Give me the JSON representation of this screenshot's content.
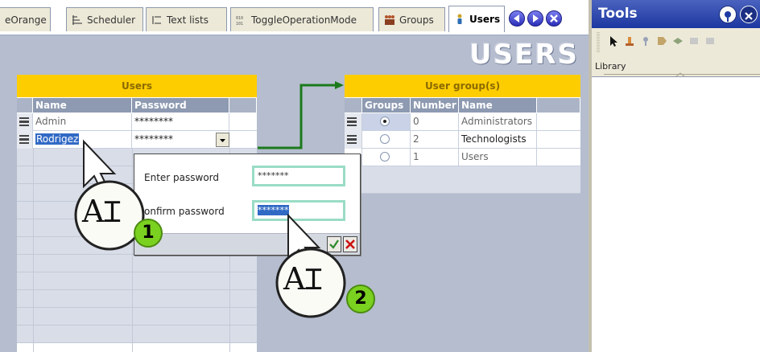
{
  "tabs": [
    {
      "label": "eOrange",
      "icon": "none"
    },
    {
      "label": "Scheduler",
      "icon": "scheduler-icon"
    },
    {
      "label": "Text lists",
      "icon": "text-list-icon"
    },
    {
      "label": "ToggleOperationMode",
      "icon": "binary-icon"
    },
    {
      "label": "Groups",
      "icon": "groups-icon"
    },
    {
      "label": "Users",
      "icon": "user-icon",
      "active": true
    }
  ],
  "page": {
    "heading": "USERS"
  },
  "users_table": {
    "title": "Users",
    "columns": [
      "Name",
      "Password"
    ],
    "rows": [
      {
        "name": "Admin",
        "password": "********"
      },
      {
        "name": "Rodrigez",
        "password": "********",
        "selected": true
      }
    ]
  },
  "groups_table": {
    "title": "User group(s)",
    "columns": [
      "Groups",
      "Number",
      "Name"
    ],
    "rows": [
      {
        "selected": true,
        "number": "0",
        "name": "Administrators"
      },
      {
        "selected": false,
        "number": "2",
        "name": "Technologists"
      },
      {
        "selected": false,
        "number": "1",
        "name": "Users"
      }
    ]
  },
  "password_dialog": {
    "enter_label": "Enter password",
    "enter_value": "*******",
    "confirm_label": "onfirm password",
    "confirm_value": "*******"
  },
  "callouts": [
    {
      "glyph": "A",
      "step": "1"
    },
    {
      "glyph": "A",
      "step": "2"
    }
  ],
  "tools": {
    "title": "Tools",
    "library_label": "Library"
  },
  "colors": {
    "table_title_bg": "#fecd00",
    "header_bg": "#8d9ab1",
    "editor_bg": "#b5bdcf",
    "tools_title_bg": "#1b37a0",
    "connector": "#1b7a1b",
    "selection": "#316ac5",
    "step_badge": "#7bd11f"
  }
}
